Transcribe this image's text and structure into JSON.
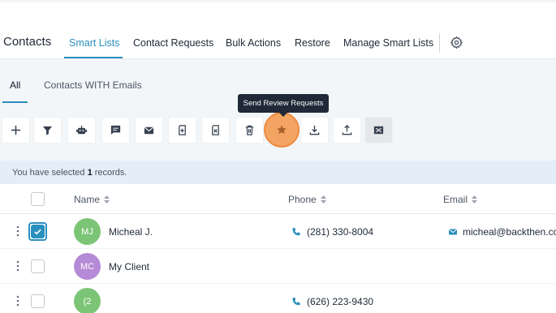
{
  "header": {
    "title": "Contacts",
    "tabs": [
      {
        "label": "Smart Lists",
        "active": true
      },
      {
        "label": "Contact Requests"
      },
      {
        "label": "Bulk Actions"
      },
      {
        "label": "Restore"
      },
      {
        "label": "Manage Smart Lists"
      }
    ],
    "settings_icon": "gear-icon"
  },
  "subtabs": [
    {
      "label": "All",
      "active": true
    },
    {
      "label": "Contacts WITH Emails"
    }
  ],
  "tooltip": "Send Review Requests",
  "toolbar": {
    "buttons": [
      "plus-icon",
      "filter-icon",
      "robot-icon",
      "message-icon",
      "mail-icon",
      "tag-add-icon",
      "tag-remove-icon",
      "trash-icon",
      "star-icon",
      "download-icon",
      "upload-icon",
      "merge-icon"
    ],
    "highlighted": "star-icon"
  },
  "banner": {
    "prefix": "You have selected",
    "count": "1",
    "suffix": "records."
  },
  "table": {
    "columns": [
      "Name",
      "Phone",
      "Email"
    ],
    "rows": [
      {
        "initials": "MJ",
        "avatar_color": "#7cc576",
        "name": "Micheal J.",
        "phone": "(281) 330-8004",
        "email": "micheal@backthen.com",
        "checked": true
      },
      {
        "initials": "MC",
        "avatar_color": "#b58ad6",
        "name": "My Client",
        "phone": "",
        "email": "",
        "checked": false
      },
      {
        "initials": "(2",
        "avatar_color": "#7cc576",
        "name": "",
        "phone": "(626) 223-9430",
        "email": "",
        "checked": false
      }
    ]
  },
  "colors": {
    "accent": "#2a8fbd",
    "highlight": "#f4a462"
  }
}
